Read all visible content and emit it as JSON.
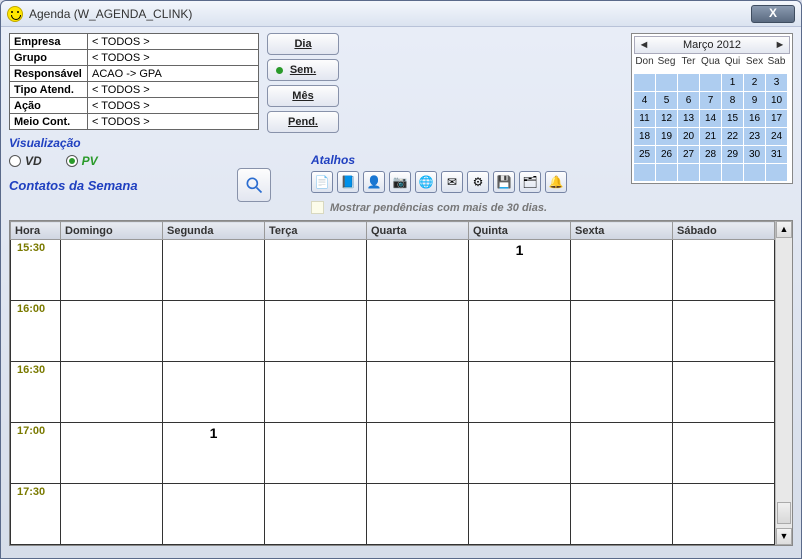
{
  "window": {
    "title": "Agenda (W_AGENDA_CLINK)"
  },
  "filters": {
    "rows": [
      {
        "label": "Empresa",
        "value": "< TODOS >"
      },
      {
        "label": "Grupo",
        "value": "< TODOS >"
      },
      {
        "label": "Responsável",
        "value": "ACAO          -> GPA"
      },
      {
        "label": "Tipo Atend.",
        "value": "< TODOS >"
      },
      {
        "label": "Ação",
        "value": "< TODOS >"
      },
      {
        "label": "Meio Cont.",
        "value": "< TODOS >"
      }
    ]
  },
  "visualizacao": {
    "title": "Visualização",
    "options": [
      {
        "label": "VD",
        "checked": false
      },
      {
        "label": "PV",
        "checked": true
      }
    ]
  },
  "section_title": "Contatos da Semana",
  "view_buttons": [
    "Dia",
    "Sem.",
    "Mês",
    "Pend."
  ],
  "active_view": "Sem.",
  "atalhos_label": "Atalhos",
  "shortcuts": [
    "📄",
    "📘",
    "👤",
    "📷",
    "🌐",
    "✉",
    "⚙",
    "💾",
    "🗂",
    "🔔"
  ],
  "pendencia_text": "Mostrar pendências com mais de 30 dias.",
  "calendar": {
    "title": "Março 2012",
    "daynames": [
      "Don",
      "Seg",
      "Ter",
      "Qua",
      "Qui",
      "Sex",
      "Sab"
    ],
    "leading_blanks": 4,
    "days": 31,
    "trailing_blanks": 7
  },
  "schedule": {
    "columns": [
      "Hora",
      "Domingo",
      "Segunda",
      "Terça",
      "Quarta",
      "Quinta",
      "Sexta",
      "Sábado"
    ],
    "rows": [
      {
        "hour": "15:30",
        "cells": [
          "",
          "",
          "",
          "",
          "1",
          "",
          ""
        ]
      },
      {
        "hour": "16:00",
        "cells": [
          "",
          "",
          "",
          "",
          "",
          "",
          ""
        ]
      },
      {
        "hour": "16:30",
        "cells": [
          "",
          "",
          "",
          "",
          "",
          "",
          ""
        ]
      },
      {
        "hour": "17:00",
        "cells": [
          "",
          "1",
          "",
          "",
          "",
          "",
          ""
        ]
      },
      {
        "hour": "17:30",
        "cells": [
          "",
          "",
          "",
          "",
          "",
          "",
          ""
        ]
      }
    ]
  }
}
